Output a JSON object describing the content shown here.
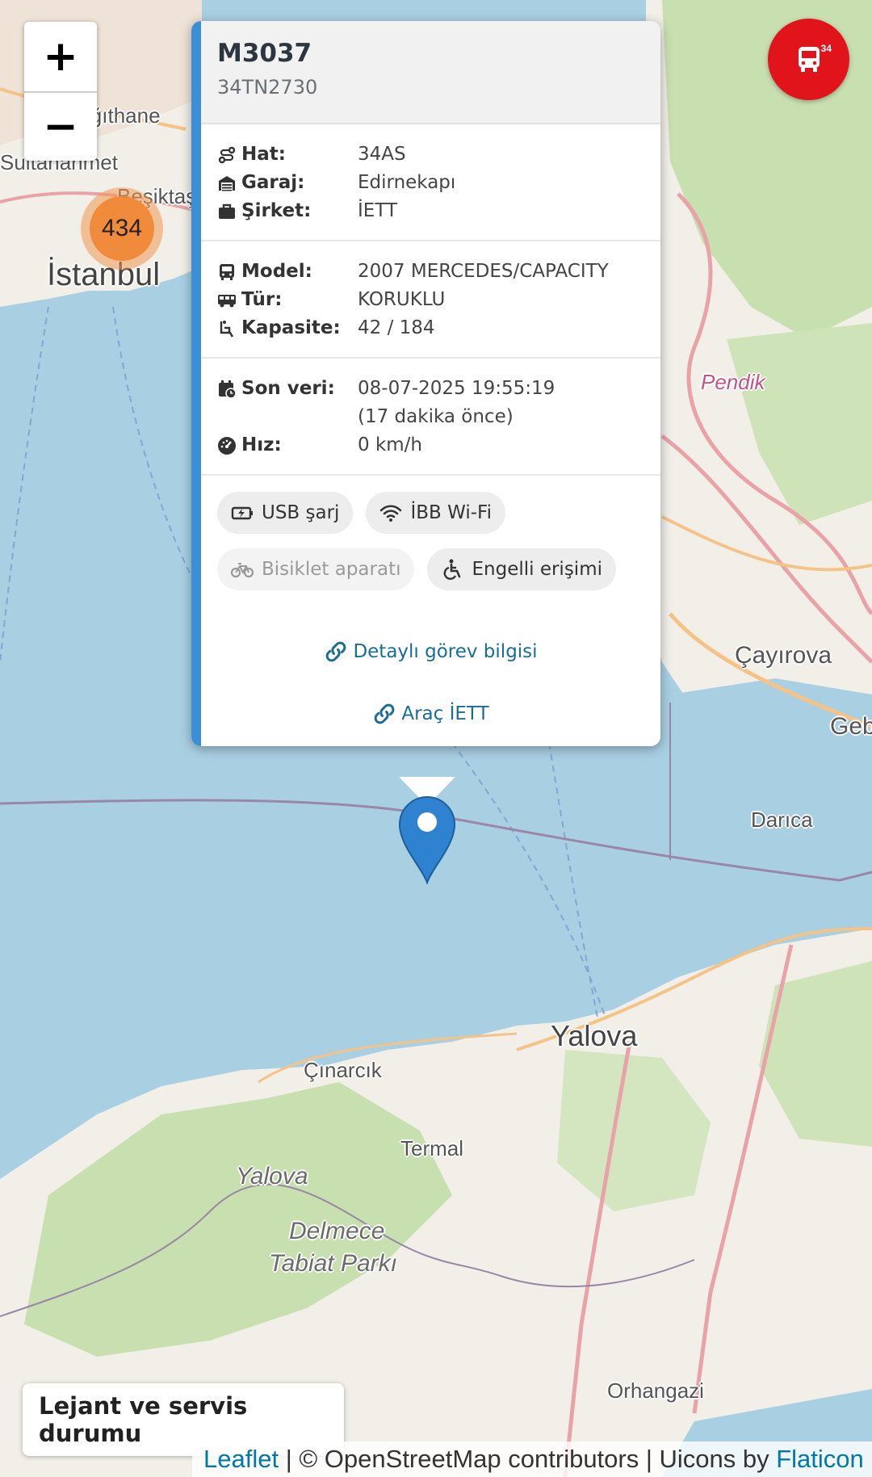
{
  "map": {
    "place_labels": [
      {
        "text": "İstanbul",
        "size": "big"
      },
      {
        "text": "Beşiktaş",
        "size": "small"
      },
      {
        "text": "Kağıthane",
        "size": "small"
      },
      {
        "text": "Sultanahmet",
        "size": "small"
      },
      {
        "text": "Pendik",
        "size": "small"
      },
      {
        "text": "Çayırova",
        "size": "mid"
      },
      {
        "text": "Gebze",
        "size": "mid"
      },
      {
        "text": "Darıca",
        "size": "small"
      },
      {
        "text": "Yalova",
        "size": "big"
      },
      {
        "text": "Çınarcık",
        "size": "small"
      },
      {
        "text": "Termal",
        "size": "small"
      },
      {
        "text": "Yalova",
        "size": "mid"
      },
      {
        "text": "Delmece",
        "size": "mid"
      },
      {
        "text": "Tabiat Parkı",
        "size": "mid"
      },
      {
        "text": "Orhangazi",
        "size": "small"
      }
    ],
    "cluster_count": "434",
    "colors": {
      "water": "#a9cfe3",
      "land": "#f2efe9",
      "forest": "#c8dfb0",
      "road_major": "#e8a2a8",
      "road_orange": "#f6c386",
      "border": "#9a86a6"
    }
  },
  "zoom": {
    "in_label": "+",
    "out_label": "−"
  },
  "fab": {
    "badge": "34",
    "icon": "bus-icon"
  },
  "popup": {
    "title": "M3037",
    "plate": "34TN2730",
    "section1": [
      {
        "icon": "route-icon",
        "label": "Hat:",
        "value": "34AS"
      },
      {
        "icon": "garage-icon",
        "label": "Garaj:",
        "value": "Edirnekapı"
      },
      {
        "icon": "briefcase-icon",
        "label": "Şirket:",
        "value": "İETT"
      }
    ],
    "section2": [
      {
        "icon": "bus-icon",
        "label": "Model:",
        "value": "2007 MERCEDES/CAPACITY"
      },
      {
        "icon": "van-icon",
        "label": "Tür:",
        "value": "KORUKLU"
      },
      {
        "icon": "seat-icon",
        "label": "Kapasite:",
        "value": "42 / 184"
      }
    ],
    "section3": {
      "last_data_label": "Son veri:",
      "last_data_value": "08-07-2025 19:55:19",
      "last_data_ago": "(17 dakika önce)",
      "speed_label": "Hız:",
      "speed_value": "0 km/h"
    },
    "features": [
      {
        "icon": "usb-charge-icon",
        "label": "USB şarj",
        "enabled": true
      },
      {
        "icon": "wifi-icon",
        "label": "İBB Wi-Fi",
        "enabled": true
      },
      {
        "icon": "bicycle-icon",
        "label": "Bisiklet aparatı",
        "enabled": false
      },
      {
        "icon": "wheelchair-icon",
        "label": "Engelli erişimi",
        "enabled": true
      }
    ],
    "link_detail": "Detaylı görev bilgisi",
    "link_arac": "Araç İETT",
    "accent_color": "#3a8fd6",
    "link_color": "#1c6c9a"
  },
  "legend": {
    "label": "Lejant ve servis durumu"
  },
  "attribution": {
    "leaflet": "Leaflet",
    "osm": " | © OpenStreetMap contributors | Uicons by ",
    "flaticon": "Flaticon"
  }
}
